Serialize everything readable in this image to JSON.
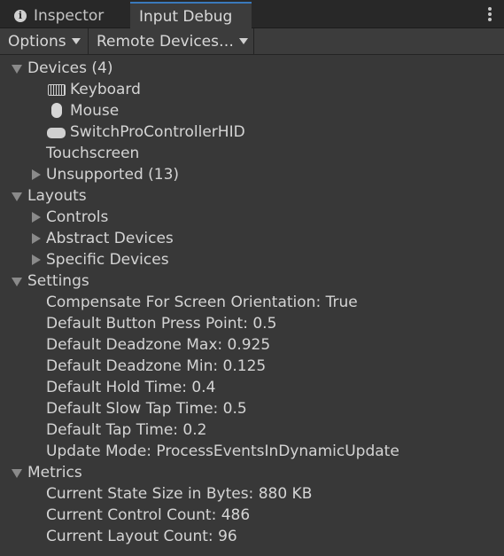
{
  "tabs": {
    "inspector_label": "Inspector",
    "debug_label": "Input Debug"
  },
  "toolbar": {
    "options_label": "Options",
    "remote_label": "Remote Devices…"
  },
  "tree": {
    "devices": {
      "label": "Devices (4)",
      "items": [
        "Keyboard",
        "Mouse",
        "SwitchProControllerHID",
        "Touchscreen"
      ],
      "unsupported": "Unsupported (13)"
    },
    "layouts": {
      "label": "Layouts",
      "items": [
        "Controls",
        "Abstract Devices",
        "Specific Devices"
      ]
    },
    "settings": {
      "label": "Settings",
      "items": [
        "Compensate For Screen Orientation: True",
        "Default Button Press Point: 0.5",
        "Default Deadzone Max: 0.925",
        "Default Deadzone Min: 0.125",
        "Default Hold Time: 0.4",
        "Default Slow Tap Time: 0.5",
        "Default Tap Time: 0.2",
        "Update Mode: ProcessEventsInDynamicUpdate"
      ]
    },
    "metrics": {
      "label": "Metrics",
      "items": [
        "Current State Size in Bytes: 880 KB",
        "Current Control Count: 486",
        "Current Layout Count: 96"
      ]
    }
  },
  "icons": {
    "inspector": "info-icon",
    "menu": "kebab-menu-icon",
    "keyboard": "keyboard-icon",
    "mouse": "mouse-icon",
    "gamepad": "gamepad-icon"
  }
}
